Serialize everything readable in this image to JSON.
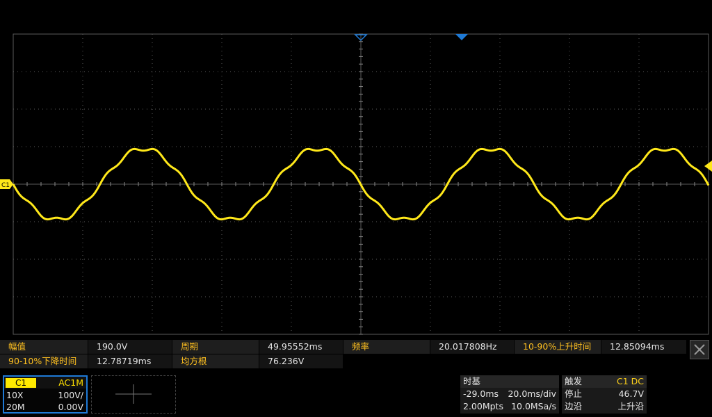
{
  "scope": {
    "channel_marker": "C1",
    "trace_color": "#ffe81a",
    "grid_color": "#5a5a5a",
    "trigger_marker_color": "#1e7ad6",
    "waveform": {
      "period_ms": 49.95552,
      "frequency_hz": 20.017808,
      "peak_to_peak_v": 190.0,
      "rms_v": 76.236,
      "divisions_horizontal": 10,
      "divisions_vertical": 8
    }
  },
  "measurements": {
    "amplitude_label": "幅值",
    "amplitude_value": "190.0V",
    "period_label": "周期",
    "period_value": "49.95552ms",
    "frequency_label": "频率",
    "frequency_value": "20.017808Hz",
    "rise_label": "10-90%上升时间",
    "rise_value": "12.85094ms",
    "fall_label": "90-10%下降时间",
    "fall_value": "12.78719ms",
    "rms_label": "均方根",
    "rms_value": "76.236V",
    "close_icon": "close-icon"
  },
  "channel1": {
    "tag": "C1",
    "coupling": "AC1M",
    "probe": "10X",
    "scale": "100V/",
    "bandwidth": "20M",
    "offset": "0.00V"
  },
  "timebase": {
    "title": "时基",
    "delay": "-29.0ms",
    "scale": "20.0ms/div",
    "memory": "2.00Mpts",
    "sample_rate": "10.0MSa/s"
  },
  "trigger": {
    "title": "触发",
    "source": "C1 DC",
    "status": "停止",
    "level": "46.7V",
    "type": "边沿",
    "slope": "上升沿"
  }
}
